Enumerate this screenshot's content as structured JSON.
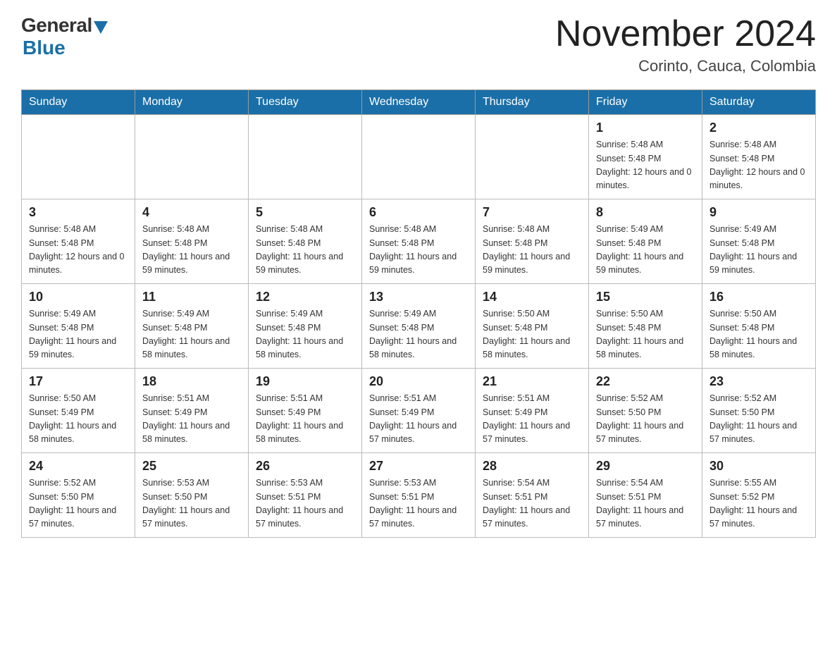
{
  "header": {
    "logo_general": "General",
    "logo_blue": "Blue",
    "month_year": "November 2024",
    "location": "Corinto, Cauca, Colombia"
  },
  "weekdays": [
    "Sunday",
    "Monday",
    "Tuesday",
    "Wednesday",
    "Thursday",
    "Friday",
    "Saturday"
  ],
  "weeks": [
    [
      {
        "day": "",
        "info": ""
      },
      {
        "day": "",
        "info": ""
      },
      {
        "day": "",
        "info": ""
      },
      {
        "day": "",
        "info": ""
      },
      {
        "day": "",
        "info": ""
      },
      {
        "day": "1",
        "info": "Sunrise: 5:48 AM\nSunset: 5:48 PM\nDaylight: 12 hours\nand 0 minutes."
      },
      {
        "day": "2",
        "info": "Sunrise: 5:48 AM\nSunset: 5:48 PM\nDaylight: 12 hours\nand 0 minutes."
      }
    ],
    [
      {
        "day": "3",
        "info": "Sunrise: 5:48 AM\nSunset: 5:48 PM\nDaylight: 12 hours\nand 0 minutes."
      },
      {
        "day": "4",
        "info": "Sunrise: 5:48 AM\nSunset: 5:48 PM\nDaylight: 11 hours\nand 59 minutes."
      },
      {
        "day": "5",
        "info": "Sunrise: 5:48 AM\nSunset: 5:48 PM\nDaylight: 11 hours\nand 59 minutes."
      },
      {
        "day": "6",
        "info": "Sunrise: 5:48 AM\nSunset: 5:48 PM\nDaylight: 11 hours\nand 59 minutes."
      },
      {
        "day": "7",
        "info": "Sunrise: 5:48 AM\nSunset: 5:48 PM\nDaylight: 11 hours\nand 59 minutes."
      },
      {
        "day": "8",
        "info": "Sunrise: 5:49 AM\nSunset: 5:48 PM\nDaylight: 11 hours\nand 59 minutes."
      },
      {
        "day": "9",
        "info": "Sunrise: 5:49 AM\nSunset: 5:48 PM\nDaylight: 11 hours\nand 59 minutes."
      }
    ],
    [
      {
        "day": "10",
        "info": "Sunrise: 5:49 AM\nSunset: 5:48 PM\nDaylight: 11 hours\nand 59 minutes."
      },
      {
        "day": "11",
        "info": "Sunrise: 5:49 AM\nSunset: 5:48 PM\nDaylight: 11 hours\nand 58 minutes."
      },
      {
        "day": "12",
        "info": "Sunrise: 5:49 AM\nSunset: 5:48 PM\nDaylight: 11 hours\nand 58 minutes."
      },
      {
        "day": "13",
        "info": "Sunrise: 5:49 AM\nSunset: 5:48 PM\nDaylight: 11 hours\nand 58 minutes."
      },
      {
        "day": "14",
        "info": "Sunrise: 5:50 AM\nSunset: 5:48 PM\nDaylight: 11 hours\nand 58 minutes."
      },
      {
        "day": "15",
        "info": "Sunrise: 5:50 AM\nSunset: 5:48 PM\nDaylight: 11 hours\nand 58 minutes."
      },
      {
        "day": "16",
        "info": "Sunrise: 5:50 AM\nSunset: 5:48 PM\nDaylight: 11 hours\nand 58 minutes."
      }
    ],
    [
      {
        "day": "17",
        "info": "Sunrise: 5:50 AM\nSunset: 5:49 PM\nDaylight: 11 hours\nand 58 minutes."
      },
      {
        "day": "18",
        "info": "Sunrise: 5:51 AM\nSunset: 5:49 PM\nDaylight: 11 hours\nand 58 minutes."
      },
      {
        "day": "19",
        "info": "Sunrise: 5:51 AM\nSunset: 5:49 PM\nDaylight: 11 hours\nand 58 minutes."
      },
      {
        "day": "20",
        "info": "Sunrise: 5:51 AM\nSunset: 5:49 PM\nDaylight: 11 hours\nand 57 minutes."
      },
      {
        "day": "21",
        "info": "Sunrise: 5:51 AM\nSunset: 5:49 PM\nDaylight: 11 hours\nand 57 minutes."
      },
      {
        "day": "22",
        "info": "Sunrise: 5:52 AM\nSunset: 5:50 PM\nDaylight: 11 hours\nand 57 minutes."
      },
      {
        "day": "23",
        "info": "Sunrise: 5:52 AM\nSunset: 5:50 PM\nDaylight: 11 hours\nand 57 minutes."
      }
    ],
    [
      {
        "day": "24",
        "info": "Sunrise: 5:52 AM\nSunset: 5:50 PM\nDaylight: 11 hours\nand 57 minutes."
      },
      {
        "day": "25",
        "info": "Sunrise: 5:53 AM\nSunset: 5:50 PM\nDaylight: 11 hours\nand 57 minutes."
      },
      {
        "day": "26",
        "info": "Sunrise: 5:53 AM\nSunset: 5:51 PM\nDaylight: 11 hours\nand 57 minutes."
      },
      {
        "day": "27",
        "info": "Sunrise: 5:53 AM\nSunset: 5:51 PM\nDaylight: 11 hours\nand 57 minutes."
      },
      {
        "day": "28",
        "info": "Sunrise: 5:54 AM\nSunset: 5:51 PM\nDaylight: 11 hours\nand 57 minutes."
      },
      {
        "day": "29",
        "info": "Sunrise: 5:54 AM\nSunset: 5:51 PM\nDaylight: 11 hours\nand 57 minutes."
      },
      {
        "day": "30",
        "info": "Sunrise: 5:55 AM\nSunset: 5:52 PM\nDaylight: 11 hours\nand 57 minutes."
      }
    ]
  ]
}
